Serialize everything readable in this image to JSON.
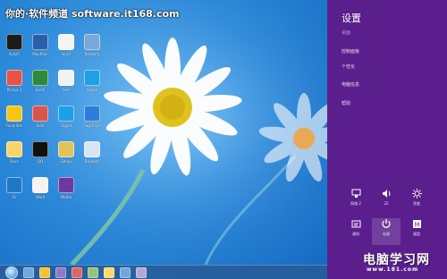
{
  "watermark": "你的·软件频道 software.it168.com",
  "colors": {
    "charm_bg": "#5a1f8c",
    "desktop_sky": "#2c8bdb",
    "taskbar": "#285a96"
  },
  "desktop_icons": [
    {
      "label": "Avast!",
      "icon": "app-icon",
      "color": "#1b1b1b"
    },
    {
      "label": "Maxthon",
      "icon": "app-icon",
      "color": "#2a5ea8"
    },
    {
      "label": "word",
      "icon": "document-icon",
      "color": "#f4f4f4"
    },
    {
      "label": "Network",
      "icon": "network-icon",
      "color": "#7aa7d6"
    },
    {
      "label": "Picasa 3",
      "icon": "picasa-icon",
      "color": "#e5534b"
    },
    {
      "label": "Excel",
      "icon": "spreadsheet-icon",
      "color": "#2d8a3e"
    },
    {
      "label": "text",
      "icon": "document-icon",
      "color": "#f2f2f2"
    },
    {
      "label": "Skype",
      "icon": "skype-icon",
      "color": "#1ea0e8"
    },
    {
      "label": "Favorites",
      "icon": "star-icon",
      "color": "#f5c518"
    },
    {
      "label": "mod",
      "icon": "document-icon",
      "color": "#d9534f"
    },
    {
      "label": "Skype",
      "icon": "skype-icon",
      "color": "#1ea0e8"
    },
    {
      "label": "SkyDrive",
      "icon": "cloud-icon",
      "color": "#2b7fd9"
    },
    {
      "label": "Docs",
      "icon": "document-icon",
      "color": "#f6d36b"
    },
    {
      "label": "QQ",
      "icon": "qq-icon",
      "color": "#111111"
    },
    {
      "label": "Setup",
      "icon": "installer-icon",
      "color": "#e2c35a"
    },
    {
      "label": "Browser",
      "icon": "window-icon",
      "color": "#d6e6f5"
    },
    {
      "label": "IE",
      "icon": "browser-icon",
      "color": "#1e78c8"
    },
    {
      "label": "Word",
      "icon": "word-icon",
      "color": "#f4f4f4"
    },
    {
      "label": "Media",
      "icon": "media-icon",
      "color": "#6a3aa2"
    }
  ],
  "taskbar": {
    "items": [
      "start",
      "explorer",
      "folder",
      "app1",
      "app2",
      "app3",
      "app4",
      "app5",
      "app6"
    ]
  },
  "charm": {
    "title": "设置",
    "menu": [
      {
        "label": "桌面",
        "dim": true
      },
      {
        "label": "控制面板",
        "dim": false
      },
      {
        "label": "个性化",
        "dim": false
      },
      {
        "label": "电脑信息",
        "dim": false
      },
      {
        "label": "帮助",
        "dim": false
      }
    ],
    "quick_settings": [
      {
        "label": "网络 2",
        "icon": "network-icon"
      },
      {
        "label": "22",
        "icon": "volume-icon"
      },
      {
        "label": "亮度",
        "icon": "brightness-icon"
      },
      {
        "label": "通知",
        "icon": "notifications-icon"
      },
      {
        "label": "电源",
        "icon": "power-icon"
      },
      {
        "label": "键盘",
        "icon": "keyboard-icon"
      }
    ]
  },
  "site_logo": "电脑学习网",
  "site_url": "www.181.com"
}
